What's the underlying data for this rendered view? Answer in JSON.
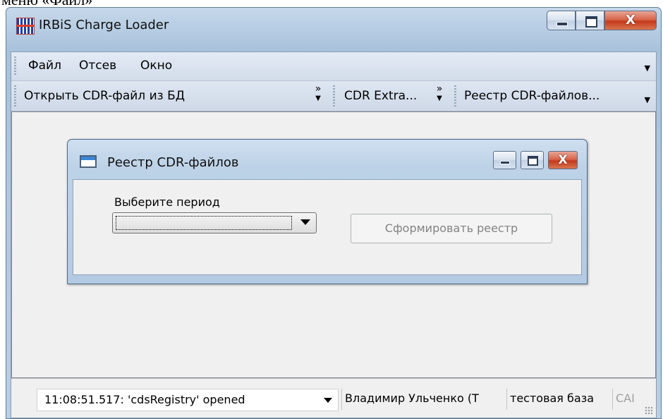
{
  "page": {
    "caption_text": "меню «Файл»"
  },
  "window": {
    "title": "IRBiS Charge Loader",
    "controls": {
      "minimize": "minimize",
      "maximize": "maximize",
      "close": "X"
    }
  },
  "menu": {
    "items": [
      {
        "label": "Файл"
      },
      {
        "label": "Отсев"
      },
      {
        "label": "Окно"
      }
    ]
  },
  "toolbar": {
    "groups": [
      {
        "label": "Открыть CDR-файл из БД",
        "overflow": "»"
      },
      {
        "label": "CDR Extra...",
        "overflow": "»"
      },
      {
        "label": "Реестр CDR-файлов..."
      }
    ]
  },
  "child_window": {
    "title": "Реестр CDR-файлов",
    "period_label": "Выберите период",
    "period_value": "",
    "build_button_label": "Сформировать реестр",
    "close": "X"
  },
  "status": {
    "log": "11:08:51.517:  'cdsRegistry' opened",
    "user": "Владимир Ульченко (Т",
    "database": "тестовая база",
    "caps": "CAI"
  },
  "colors": {
    "title_gradient": "#b7cde3",
    "close_button": "#c43a1c",
    "disabled_text": "#838383",
    "app_icon_blue": "#1f3fa8",
    "app_icon_red": "#e23b2a"
  }
}
